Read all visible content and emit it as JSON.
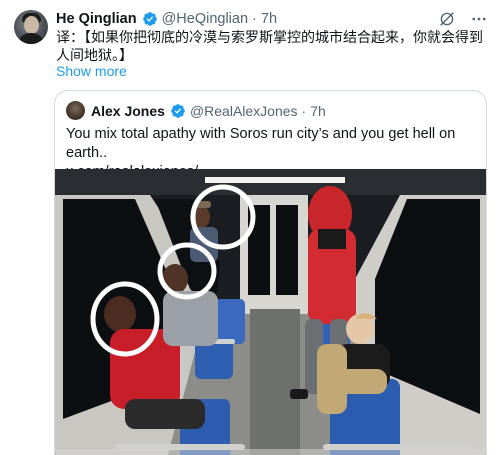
{
  "tweet": {
    "author_name": "He Qinglian",
    "author_handle": "@HeQinglian",
    "separator": "·",
    "time": "7h",
    "text": "译：【如果你把彻底的冷漠与索罗斯掌控的城市结合起来，你就会得到人间地狱。】",
    "show_more": "Show more",
    "verified_color": "#1d9bf0"
  },
  "quote": {
    "author_name": "Alex Jones",
    "author_handle": "@RealAlexJones",
    "separator": "·",
    "time": "7h",
    "text_line1": "You mix total apathy with Soros run city’s and you get hell on earth..",
    "text_line2": "x.com/realalexjones/..."
  },
  "icons": {
    "verified": "verified-badge-icon",
    "grok": "grok-icon",
    "more": "more-options-icon"
  }
}
